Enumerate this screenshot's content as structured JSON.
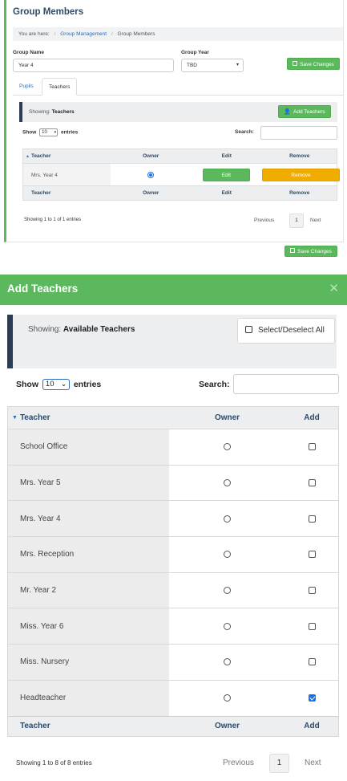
{
  "top": {
    "title": "Group Members",
    "breadcrumb": {
      "prefix": "You are here:",
      "link": "Group Management",
      "current": "Group Members"
    },
    "group_name_label": "Group Name",
    "group_name_value": "Year 4",
    "group_year_label": "Group Year",
    "group_year_value": "TBD",
    "save_label": "Save Changes",
    "tabs": [
      {
        "label": "Pupils",
        "active": false
      },
      {
        "label": "Teachers",
        "active": true
      }
    ],
    "showing_prefix": "Showing:",
    "showing_value": "Teachers",
    "add_teachers_label": "Add Teachers",
    "show_label": "Show",
    "entries_value": "10",
    "entries_label": "entries",
    "search_label": "Search:",
    "table": {
      "headers": [
        "Teacher",
        "Owner",
        "Edit",
        "Remove"
      ],
      "rows": [
        {
          "teacher": "Mrs. Year 4",
          "owner": true,
          "edit_label": "Edit",
          "remove_label": "Remove"
        }
      ]
    },
    "info": "Showing 1 to 1 of 1 entries",
    "prev_label": "Previous",
    "page": "1",
    "next_label": "Next",
    "save_bottom_label": "Save Changes"
  },
  "modal": {
    "title": "Add Teachers",
    "close_glyph": "✕",
    "showing_prefix": "Showing:",
    "showing_value": "Available Teachers",
    "select_all_label": "Select/Deselect All",
    "show_label": "Show",
    "entries_value": "10",
    "entries_label": "entries",
    "search_label": "Search:",
    "headers": [
      "Teacher",
      "Owner",
      "Add"
    ],
    "rows": [
      {
        "teacher": "School Office",
        "owner": false,
        "add": false
      },
      {
        "teacher": "Mrs. Year 5",
        "owner": false,
        "add": false
      },
      {
        "teacher": "Mrs. Year 4",
        "owner": false,
        "add": false
      },
      {
        "teacher": "Mrs. Reception",
        "owner": false,
        "add": false
      },
      {
        "teacher": "Mr. Year 2",
        "owner": false,
        "add": false
      },
      {
        "teacher": "Miss. Year 6",
        "owner": false,
        "add": false
      },
      {
        "teacher": "Miss. Nursery",
        "owner": false,
        "add": false
      },
      {
        "teacher": "Headteacher",
        "owner": false,
        "add": true
      }
    ],
    "info": "Showing 1 to 8 of 8 entries",
    "prev_label": "Previous",
    "page": "1",
    "next_label": "Next"
  },
  "colors": {
    "accent_green": "#5cb85c",
    "remove_orange": "#f0ad00",
    "navy": "#2b3c56",
    "link_blue": "#2a6dc0"
  }
}
